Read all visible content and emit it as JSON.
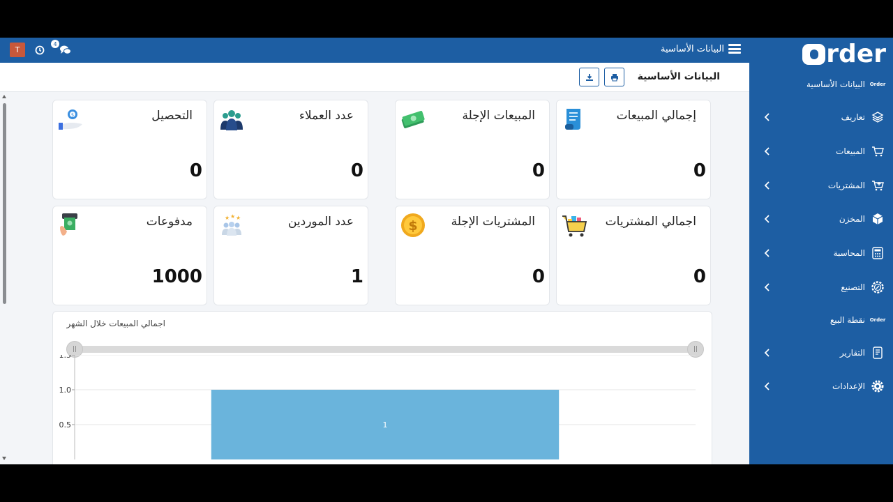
{
  "app": {
    "logo_text": "rder",
    "logo_letter": "O"
  },
  "topbar": {
    "title": "البيانات الأساسية",
    "avatar_letter": "T",
    "chat_badge": "4"
  },
  "page": {
    "title": "البيانات الأساسية"
  },
  "sidebar": {
    "items": [
      {
        "label": "البيانات الأساسية",
        "icon": "order-mini-icon",
        "has_chevron": false
      },
      {
        "label": "تعاريف",
        "icon": "layers-icon",
        "has_chevron": true
      },
      {
        "label": "المبيعات",
        "icon": "cart-icon",
        "has_chevron": true
      },
      {
        "label": "المشتريات",
        "icon": "cart-plus-icon",
        "has_chevron": true
      },
      {
        "label": "المخزن",
        "icon": "box-icon",
        "has_chevron": true
      },
      {
        "label": "المحاسبة",
        "icon": "calculator-icon",
        "has_chevron": true
      },
      {
        "label": "التصنيع",
        "icon": "factory-gear-icon",
        "has_chevron": true
      },
      {
        "label": "نقطة البيع",
        "icon": "order-mini-icon",
        "has_chevron": false
      },
      {
        "label": "التقارير",
        "icon": "report-icon",
        "has_chevron": true
      },
      {
        "label": "الإعدادات",
        "icon": "gear-icon",
        "has_chevron": true
      }
    ],
    "mini_logo": "Order"
  },
  "cards": [
    {
      "title": "إجمالي المبيعات",
      "value": "0",
      "icon": "receipt-scroll-icon"
    },
    {
      "title": "المبيعات الإجلة",
      "value": "0",
      "icon": "money-stack-icon"
    },
    {
      "title": "عدد العملاء",
      "value": "0",
      "icon": "customers-group-icon"
    },
    {
      "title": "التحصيل",
      "value": "0",
      "icon": "hand-coin-icon"
    },
    {
      "title": "اجمالي المشتريات",
      "value": "0",
      "icon": "shopping-cart-icon"
    },
    {
      "title": "المشتريات الإجلة",
      "value": "0",
      "icon": "gold-coin-icon"
    },
    {
      "title": "عدد الموردين",
      "value": "1",
      "icon": "suppliers-group-icon"
    },
    {
      "title": "مدفوعات",
      "value": "1000",
      "icon": "cash-payment-icon"
    }
  ],
  "chart_panel": {
    "title": "اجمالي المبيعات خلال الشهر",
    "slider_handle_glyph": "||"
  },
  "chart_data": {
    "type": "bar",
    "categories": [
      ""
    ],
    "values": [
      1
    ],
    "data_labels": [
      "1"
    ],
    "title": "اجمالي المبيعات خلال الشهر",
    "xlabel": "",
    "ylabel": "",
    "ylim": [
      0,
      1.5
    ],
    "yticks": [
      "1.5",
      "1.0",
      "0.5"
    ],
    "grid": true,
    "bar_color": "#6ab4dc"
  },
  "colors": {
    "brand": "#1d5ea3",
    "bar": "#6ab4dc"
  }
}
